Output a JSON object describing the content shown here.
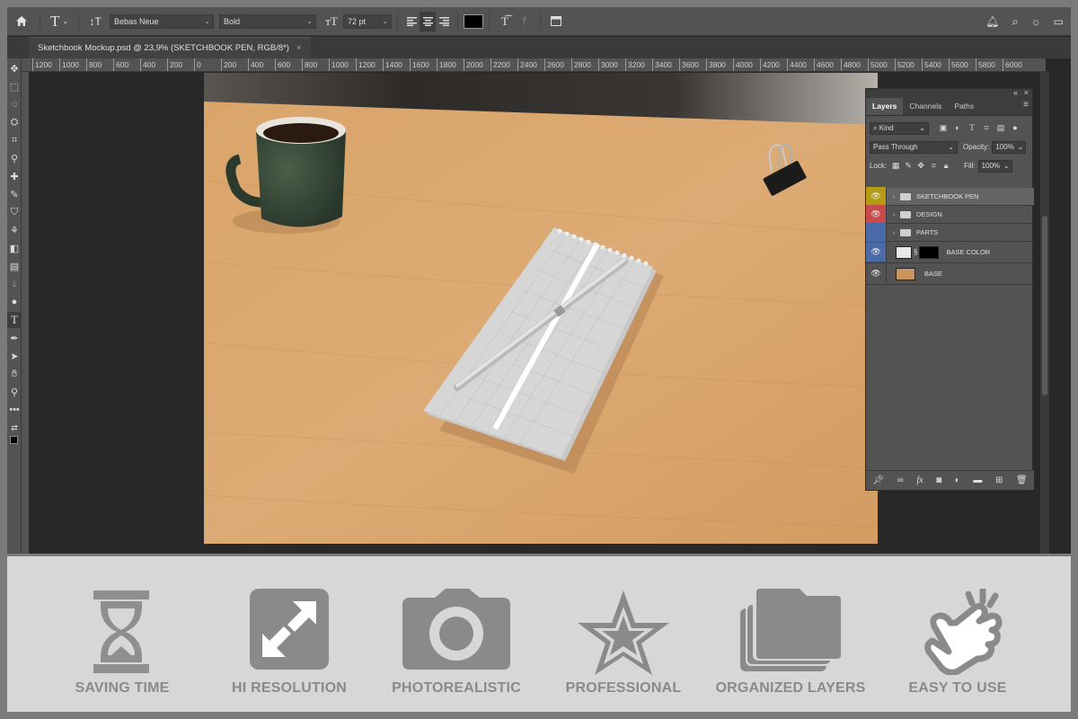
{
  "options_bar": {
    "font_family": "Bebas Neue",
    "font_style": "Bold",
    "font_size": "72 pt",
    "text_color": "#000000"
  },
  "document": {
    "tab_title": "Sketchbook Mockup.psd @ 23,9% (SKETCHBOOK PEN, RGB/8*)",
    "tab_close": "×"
  },
  "ruler": {
    "ticks": [
      "1200",
      "1000",
      "800",
      "600",
      "400",
      "200",
      "0",
      "200",
      "400",
      "600",
      "800",
      "1000",
      "1200",
      "1400",
      "1600",
      "1800",
      "2000",
      "2200",
      "2400",
      "2600",
      "2800",
      "3000",
      "3200",
      "3400",
      "3600",
      "3800",
      "4000",
      "4200",
      "4400",
      "4600",
      "4800",
      "5000",
      "5200",
      "5400",
      "5600",
      "5800",
      "6000"
    ]
  },
  "layers_panel": {
    "tabs": [
      "Layers",
      "Channels",
      "Paths"
    ],
    "active_tab": "Layers",
    "filter_kind": "Kind",
    "blend_mode": "Pass Through",
    "opacity_label": "Opacity:",
    "opacity_value": "100%",
    "lock_label": "Lock:",
    "fill_label": "Fill:",
    "fill_value": "100%",
    "layers": [
      {
        "name": "SKETCHBOOK PEN",
        "type": "group",
        "color": "#b39b12",
        "selected": true
      },
      {
        "name": "DESIGN",
        "type": "group",
        "color": "#c84a4a",
        "selected": false
      },
      {
        "name": "PARTS",
        "type": "group",
        "color": "#4a6aa8",
        "selected": false
      },
      {
        "name": "BASE COLOR",
        "type": "fill",
        "color": "#4a6aa8",
        "selected": false
      },
      {
        "name": "BASE",
        "type": "image",
        "color": "",
        "selected": false
      }
    ]
  },
  "features": [
    {
      "label": "SAVING TIME",
      "icon": "hourglass-icon"
    },
    {
      "label": "HI RESOLUTION",
      "icon": "expand-arrows-icon"
    },
    {
      "label": "PHOTOREALISTIC",
      "icon": "camera-icon"
    },
    {
      "label": "PROFESSIONAL",
      "icon": "star-icon"
    },
    {
      "label": "ORGANIZED LAYERS",
      "icon": "stacked-folders-icon"
    },
    {
      "label": "EASY TO USE",
      "icon": "tap-hand-icon"
    }
  ]
}
